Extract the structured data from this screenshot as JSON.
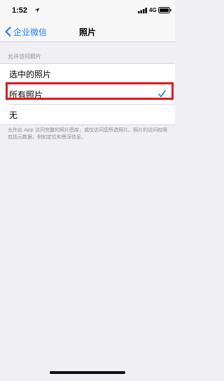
{
  "status_bar": {
    "time": "1:52",
    "network": "4G",
    "icons": [
      "location-icon",
      "signal-icon",
      "battery-icon"
    ]
  },
  "nav": {
    "back_label": "企业微信",
    "title": "照片"
  },
  "section": {
    "header": "允许访问照片",
    "options": [
      {
        "label": "选中的照片",
        "selected": false
      },
      {
        "label": "所有照片",
        "selected": true
      },
      {
        "label": "无",
        "selected": false
      }
    ],
    "footer": "允许此 App 访问完整的照片图库，或仅访问您所选照片。照片的访问权限包括元数据，例如定位和景深信息。"
  },
  "colors": {
    "accent": "#1a7cf5",
    "highlight_border": "#e0151c",
    "background": "#efeff4"
  }
}
